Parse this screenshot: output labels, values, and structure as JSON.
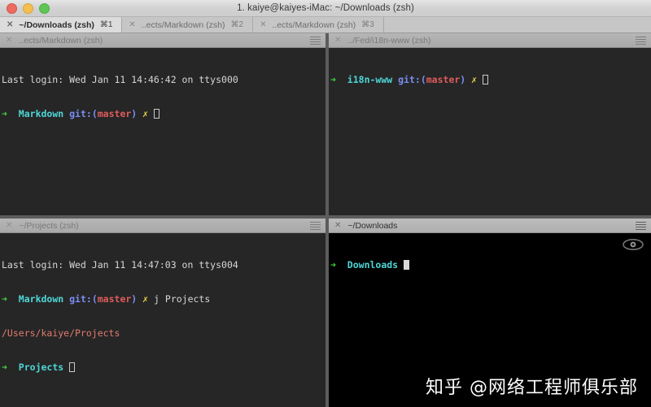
{
  "window": {
    "title": "1. kaiye@kaiyes-iMac: ~/Downloads (zsh)",
    "traffic_lights": {
      "close": "close-button",
      "minimize": "minimize-button",
      "zoom": "zoom-button"
    },
    "colors": {
      "close": "#ec6a5e",
      "minimize": "#f4bf4f",
      "zoom": "#61c555",
      "titlebar": "#d2d2d2",
      "tabbar": "#c6c6c6",
      "tab_active": "#dcdcdc",
      "pane_header": "#a9a9a9",
      "pane_bg_inactive": "#262626",
      "pane_bg_active": "#000000",
      "divider": "#5c5c5c"
    }
  },
  "tabs": [
    {
      "close": "✕",
      "label": "~/Downloads (zsh)",
      "shortcut": "⌘1",
      "active": true
    },
    {
      "close": "✕",
      "label": "..ects/Markdown (zsh)",
      "shortcut": "⌘2",
      "active": false
    },
    {
      "close": "✕",
      "label": "..ects/Markdown (zsh)",
      "shortcut": "⌘3",
      "active": false
    }
  ],
  "panes": {
    "top_left": {
      "close": "✕",
      "title": "..ects/Markdown (zsh)",
      "menu_icon": "hamburger-icon",
      "active": false,
      "lines": {
        "last_login": "Last login: Wed Jan 11 14:46:42 on ttys000",
        "arrow": "➜",
        "dir": "Markdown",
        "git_open": "git:(",
        "branch": "master",
        "git_close": ")",
        "dirty": "✗"
      }
    },
    "top_right": {
      "close": "✕",
      "title": "../Fed/i18n-www (zsh)",
      "menu_icon": "hamburger-icon",
      "active": false,
      "lines": {
        "arrow": "➜",
        "dir": "i18n-www",
        "git_open": "git:(",
        "branch": "master",
        "git_close": ")",
        "dirty": "✗"
      }
    },
    "bottom_left": {
      "close": "✕",
      "title": "~/Projects (zsh)",
      "menu_icon": "hamburger-icon",
      "active": false,
      "lines": {
        "last_login": "Last login: Wed Jan 11 14:47:03 on ttys004",
        "arrow": "➜",
        "dir": "Markdown",
        "git_open": "git:(",
        "branch": "master",
        "git_close": ")",
        "dirty": "✗",
        "command": "j Projects",
        "output_path": "/Users/kaiye/Projects",
        "arrow2": "➜",
        "dir2": "Projects"
      }
    },
    "bottom_right": {
      "close": "✕",
      "title": "~/Downloads",
      "menu_icon": "hamburger-icon",
      "active": true,
      "badge_icon": "eye-icon",
      "lines": {
        "arrow": "➜",
        "dir": "Downloads"
      }
    }
  },
  "watermark": {
    "text": "知乎 @网络工程师俱乐部"
  }
}
